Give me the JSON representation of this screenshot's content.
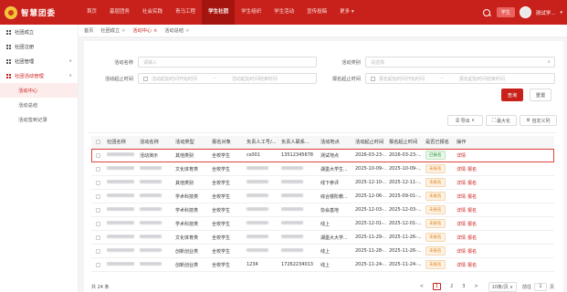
{
  "topbar": {
    "logo_text": "智慧团委",
    "nav": [
      "首页",
      "基层团务",
      "社会实践",
      "青马工程",
      "学生社团",
      "学生组织",
      "学生活动",
      "宣传投稿",
      "更多"
    ],
    "active_nav": "学生社团",
    "role_badge": "学生",
    "username": "测试学...",
    "accent_color": "#c8211b"
  },
  "sidebar": {
    "items": [
      {
        "label": "社团成立",
        "icon": "grid-icon"
      },
      {
        "label": "社团注册",
        "icon": "grid-icon"
      },
      {
        "label": "社团管理",
        "icon": "grid-icon",
        "chevron": "∨"
      },
      {
        "label": "社团活动管理",
        "icon": "grid-icon",
        "chevron": "∧"
      }
    ],
    "sub_items": [
      "活动中心",
      "活动总结",
      "活动签到记录"
    ]
  },
  "tabs": [
    {
      "label": "首页"
    },
    {
      "label": "社团成立",
      "close": "×"
    },
    {
      "label": "活动中心",
      "close": "×"
    },
    {
      "label": "活动总结",
      "close": "×"
    }
  ],
  "filters": {
    "activity_name_label": "活动名称",
    "activity_name_placeholder": "请输入",
    "activity_type_label": "活动类别",
    "activity_type_placeholder": "请选择",
    "activity_time_label": "活动起止时间",
    "time_start_placeholder": "活动起始时间开始时间",
    "time_end_placeholder": "活动起始时间结束时间",
    "signup_time_label": "报名起止时间",
    "signup_start_placeholder": "报名起始时间开始时间",
    "signup_end_placeholder": "报名起始时间结束时间",
    "range_sep": "-",
    "query_button": "查询",
    "reset_button": "重置"
  },
  "toolbar": {
    "export": "导出",
    "maximize": "最大化",
    "custom_columns": "自定义列"
  },
  "table": {
    "headers": [
      "社团名称",
      "活动名称",
      "活动类型",
      "报名对象",
      "负责人工号/...",
      "负责人联系...",
      "活动地点",
      "活动起止时间",
      "报名起止时间",
      "是否已报名",
      "操作"
    ],
    "rows": [
      {
        "club": "",
        "name": "活动演示",
        "type": "其他类别",
        "target": "全校学生",
        "staff_id": "cs001",
        "phone": "13512345678",
        "place": "测试地点",
        "act_time": "2026-03-23-...",
        "sign_time": "2026-03-23-...",
        "status": "已报名",
        "status_kind": "green",
        "ops": [
          "详情"
        ]
      },
      {
        "club": "",
        "name": "",
        "type": "文化体育类",
        "target": "全校学生",
        "staff_id": "",
        "phone": "",
        "place": "湖墨大学生...",
        "act_time": "2025-10-09-...",
        "sign_time": "2025-10-09-...",
        "status": "未报名",
        "status_kind": "orange",
        "ops": [
          "详情",
          "报名"
        ]
      },
      {
        "club": "",
        "name": "",
        "type": "其他类别",
        "target": "全校学生",
        "staff_id": "",
        "phone": "",
        "place": "线下参评",
        "act_time": "2025-12-10-...",
        "sign_time": "2025-12-11-...",
        "status": "未报名",
        "status_kind": "orange",
        "ops": [
          "详情",
          "报名"
        ]
      },
      {
        "club": "",
        "name": "",
        "type": "学术科技类",
        "target": "全校学生",
        "staff_id": "",
        "phone": "",
        "place": "综合楼阶教...",
        "act_time": "2025-12-06-...",
        "sign_time": "2025-09-01-...",
        "status": "未报名",
        "status_kind": "orange",
        "ops": [
          "详情",
          "报名"
        ]
      },
      {
        "club": "",
        "name": "",
        "type": "学术科技类",
        "target": "全校学生",
        "staff_id": "",
        "phone": "",
        "place": "协会基地",
        "act_time": "2025-12-03-...",
        "sign_time": "2025-12-03-...",
        "status": "未报名",
        "status_kind": "orange",
        "ops": [
          "详情",
          "报名"
        ]
      },
      {
        "club": "",
        "name": "",
        "type": "学术科技类",
        "target": "全校学生",
        "staff_id": "",
        "phone": "",
        "place": "线上",
        "act_time": "2025-12-01-...",
        "sign_time": "2025-12-01-...",
        "status": "未报名",
        "status_kind": "orange",
        "ops": [
          "详情",
          "报名"
        ]
      },
      {
        "club": "",
        "name": "",
        "type": "文化体育类",
        "target": "全校学生",
        "staff_id": "",
        "phone": "",
        "place": "湖墨大大学...",
        "act_time": "2025-11-29-...",
        "sign_time": "2025-11-26-...",
        "status": "未报名",
        "status_kind": "orange",
        "ops": [
          "详情",
          "报名"
        ]
      },
      {
        "club": "",
        "name": "",
        "type": "创新创业类",
        "target": "全校学生",
        "staff_id": "",
        "phone": "",
        "place": "线上",
        "act_time": "2025-11-28-...",
        "sign_time": "2025-11-26-...",
        "status": "未报名",
        "status_kind": "orange",
        "ops": [
          "详情",
          "报名"
        ]
      },
      {
        "club": "",
        "name": "",
        "type": "创新创业类",
        "target": "全校学生",
        "staff_id": "1234",
        "phone": "17262234013",
        "place": "线上",
        "act_time": "2025-11-24-...",
        "sign_time": "2025-11-24-...",
        "status": "未报名",
        "status_kind": "orange",
        "ops": [
          "详情",
          "报名"
        ]
      }
    ]
  },
  "pager": {
    "total": "共 24 条",
    "prev": "<",
    "pages": [
      "1",
      "2",
      "3"
    ],
    "current": "1",
    "next": ">",
    "page_size": "10条/页",
    "goto_label": "前往",
    "goto_value": "1",
    "page_unit": "页"
  }
}
